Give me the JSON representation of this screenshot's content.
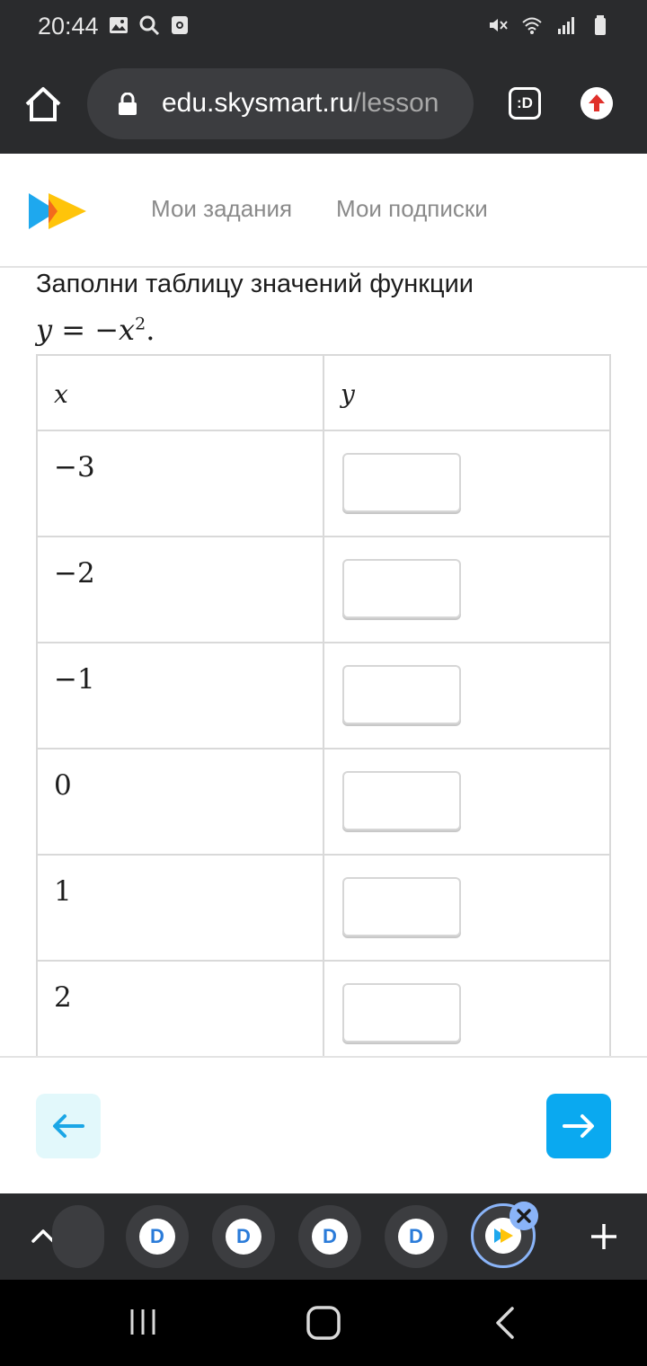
{
  "status_bar": {
    "time": "20:44",
    "left_icons": [
      "gallery-icon",
      "search-icon",
      "screen-record-icon"
    ],
    "right_icons": [
      "mute-icon",
      "wifi-icon",
      "signal-icon",
      "battery-icon"
    ]
  },
  "browser": {
    "url_domain": "edu.skysmart.ru",
    "url_path": "/lesson",
    "tabs_label": ":D"
  },
  "site": {
    "nav": {
      "tasks": "Мои задания",
      "subscriptions": "Мои подписки"
    }
  },
  "task": {
    "instruction": "Заполни таблицу значений функции",
    "formula": {
      "lhs": "y",
      "equals": "=",
      "minus": "−",
      "var": "x",
      "exponent": "2",
      "end": "."
    },
    "table": {
      "header_x": "x",
      "header_y": "y",
      "rows": [
        {
          "x": "−3",
          "y": ""
        },
        {
          "x": "−2",
          "y": ""
        },
        {
          "x": "−1",
          "y": ""
        },
        {
          "x": "0",
          "y": ""
        },
        {
          "x": "1",
          "y": ""
        },
        {
          "x": "2",
          "y": ""
        }
      ]
    }
  },
  "lesson_nav": {
    "prev_icon": "arrow-left-icon",
    "next_icon": "arrow-right-icon"
  },
  "colors": {
    "next_button": "#0aa9f0",
    "prev_button_bg": "#e2f8fb",
    "browser_chrome": "#2a2b2d",
    "active_tab_ring": "#8ab4f8"
  }
}
